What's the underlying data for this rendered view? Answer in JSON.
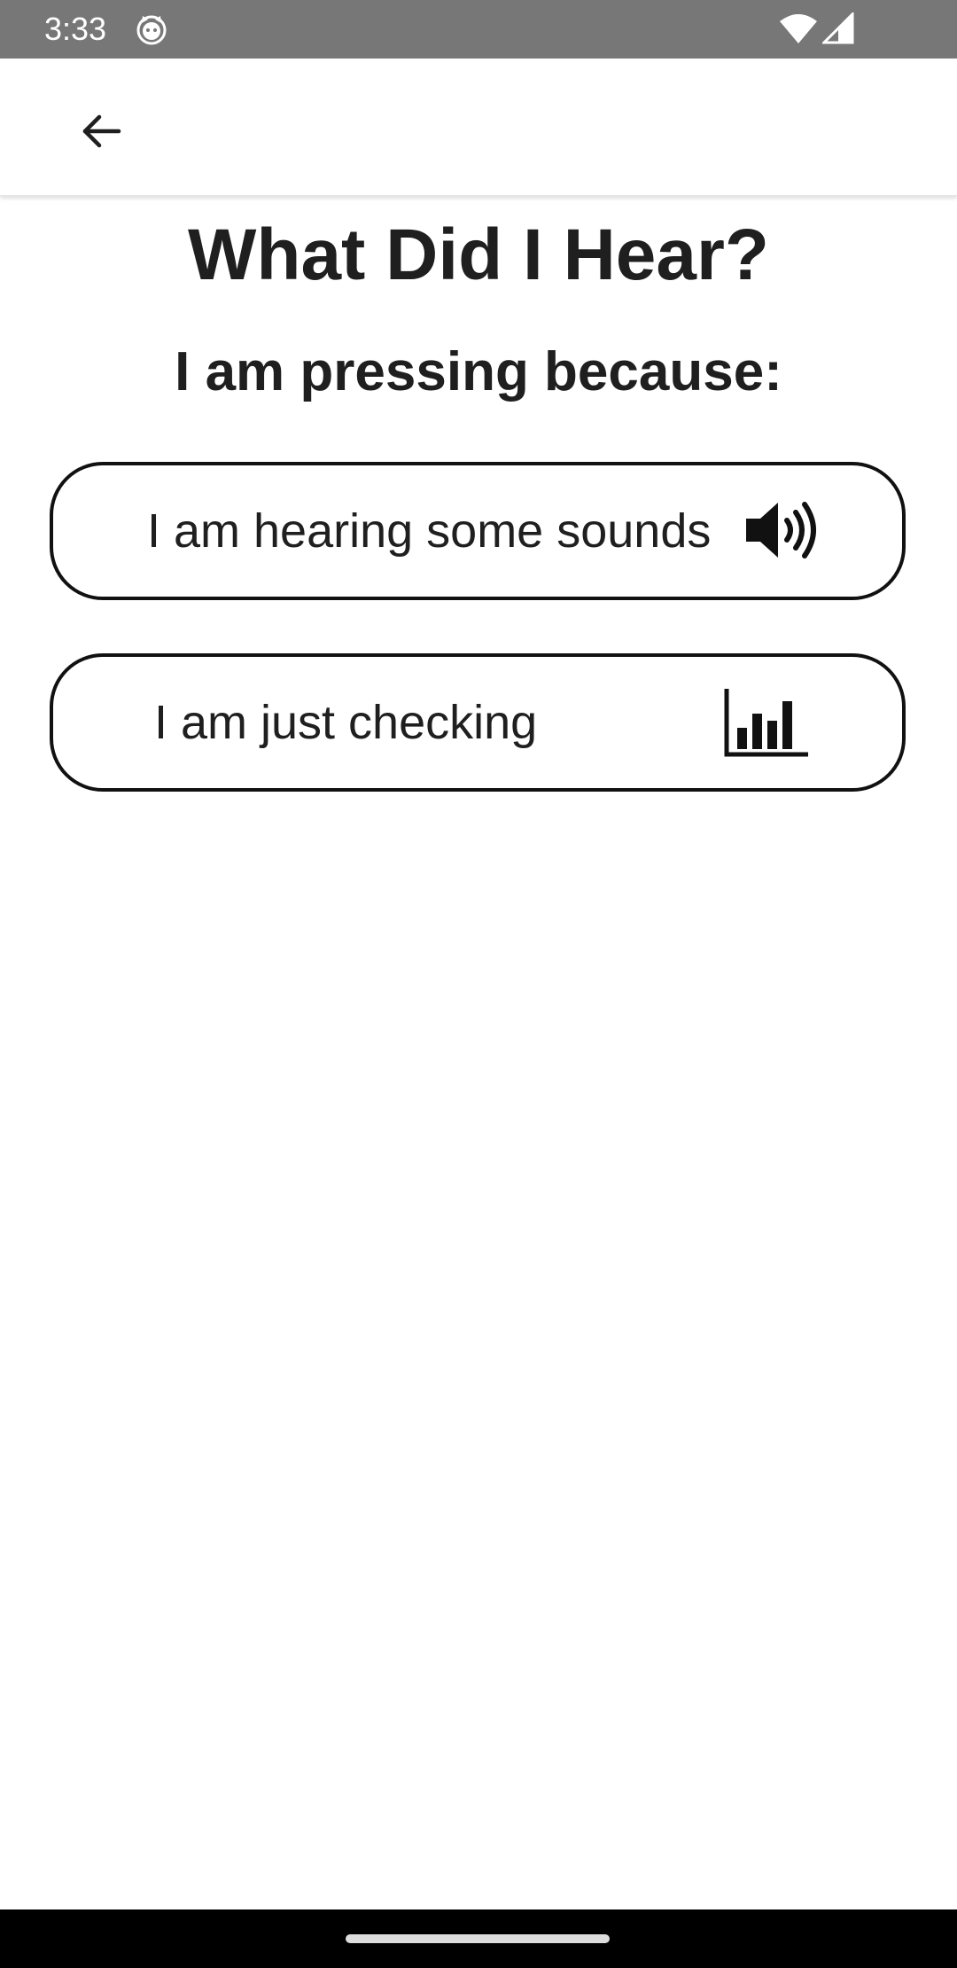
{
  "status_bar": {
    "time": "3:33",
    "icons": [
      "cat-notification-icon",
      "wifi-icon",
      "cellular-signal-icon"
    ]
  },
  "app_bar": {
    "back_icon": "arrow-left-icon"
  },
  "main": {
    "title": "What Did I Hear?",
    "subtitle": "I am pressing because:",
    "options": [
      {
        "label": "I am hearing some sounds",
        "icon": "speaker-volume-icon"
      },
      {
        "label": "I am just checking",
        "icon": "bar-chart-icon"
      }
    ]
  },
  "colors": {
    "status_bar": "#777777",
    "text": "#1f1f1f",
    "border": "#111111",
    "nav_bar": "#000000"
  }
}
